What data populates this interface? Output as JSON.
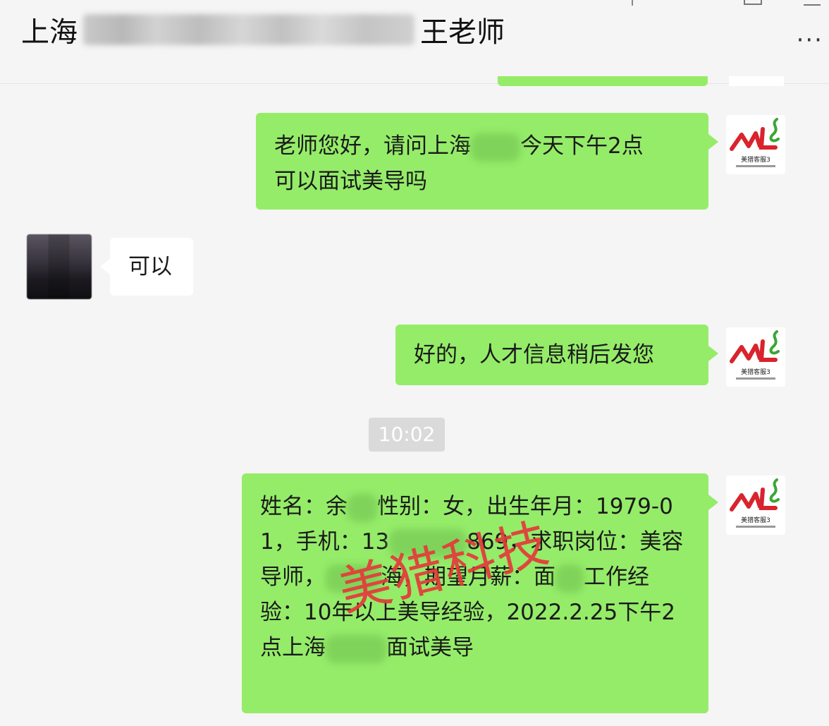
{
  "header": {
    "title_prefix": "上海",
    "title_suffix": "王老师",
    "more_icon": "···"
  },
  "messages": {
    "m1": {
      "part1": "老师您好，请问上海",
      "part2": "今天下午2点",
      "part3": "可以面试美导吗"
    },
    "m2": {
      "text": "可以"
    },
    "m3": {
      "text": "好的，人才信息稍后发您"
    },
    "timestamp": "10:02",
    "m4": {
      "p1": "姓名：余",
      "p2": "性别：女，出生年月：1979-01，手机：13",
      "p3": "869，求职岗位：美容导师，",
      "p4": "海，期望月薪：面",
      "p5": "工作经验：10年以上美导经验，2022.2.25下午2点上海",
      "p6": "面试美导"
    }
  },
  "avatar_logo_text": "美猎客服3",
  "watermark": "美猎科技",
  "colors": {
    "my_bubble": "#95ec69",
    "other_bubble": "#ffffff",
    "background": "#f5f5f5",
    "logo_red": "#d9232d",
    "logo_green": "#3aa635"
  }
}
